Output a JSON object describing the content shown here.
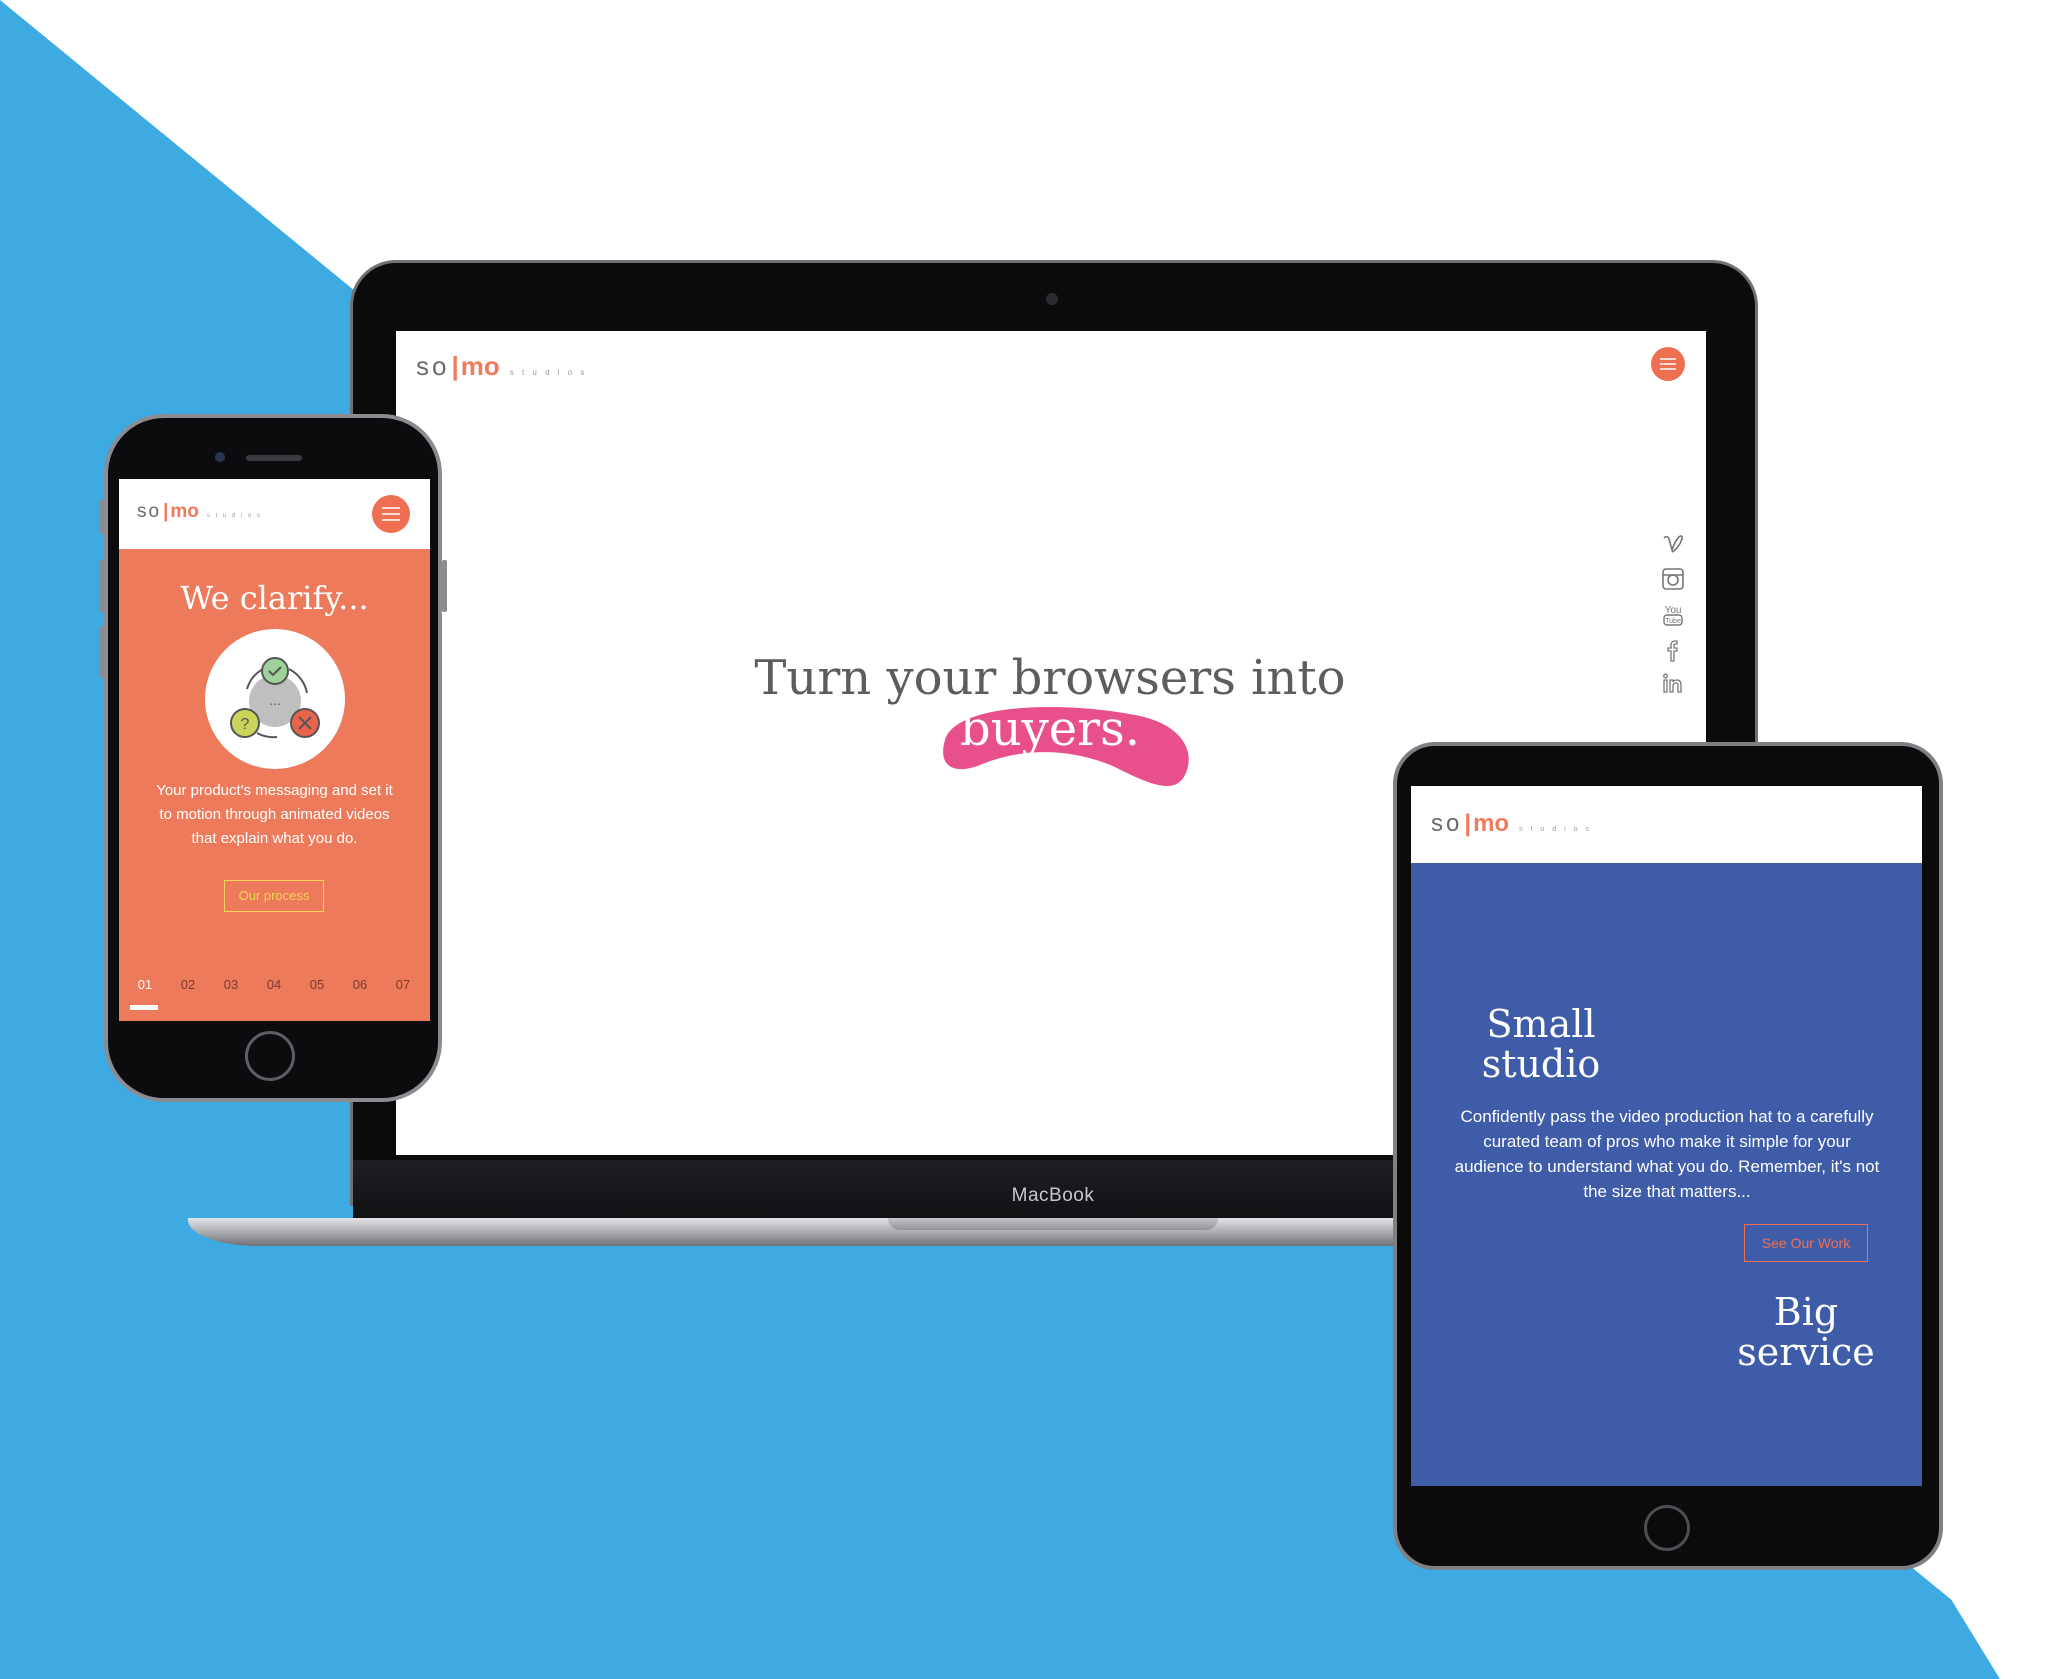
{
  "brand": {
    "logo_so": "so",
    "logo_bar": "|",
    "logo_mo": "mo",
    "logo_studios": "s t u d i o s",
    "accent_color": "#ef6f52",
    "background_blue": "#3daae2"
  },
  "laptop": {
    "device_label": "MacBook",
    "menu_icon": "hamburger-menu-icon",
    "social_icons": [
      "vimeo-icon",
      "instagram-icon",
      "youtube-icon",
      "facebook-icon",
      "linkedin-icon"
    ],
    "headline_line1": "Turn your browsers into",
    "headline_accent": "buyers.",
    "accent_swash_color": "#e8508c"
  },
  "phone": {
    "title": "We clarify...",
    "body": "Your product's messaging and set it to motion through animated videos that explain what you do.",
    "cta": "Our process",
    "steps": [
      "01",
      "02",
      "03",
      "04",
      "05",
      "06",
      "07"
    ],
    "active_step": "01",
    "screen_color": "#ee7a5c"
  },
  "tablet": {
    "heading_1": "Small studio",
    "body": "Confidently pass the video production hat to a carefully curated team of pros who make it simple for your audience to understand what you do. Remember, it's not the size that matters...",
    "cta": "See Our Work",
    "heading_2": "Big service",
    "screen_color": "#3e5ca8"
  }
}
